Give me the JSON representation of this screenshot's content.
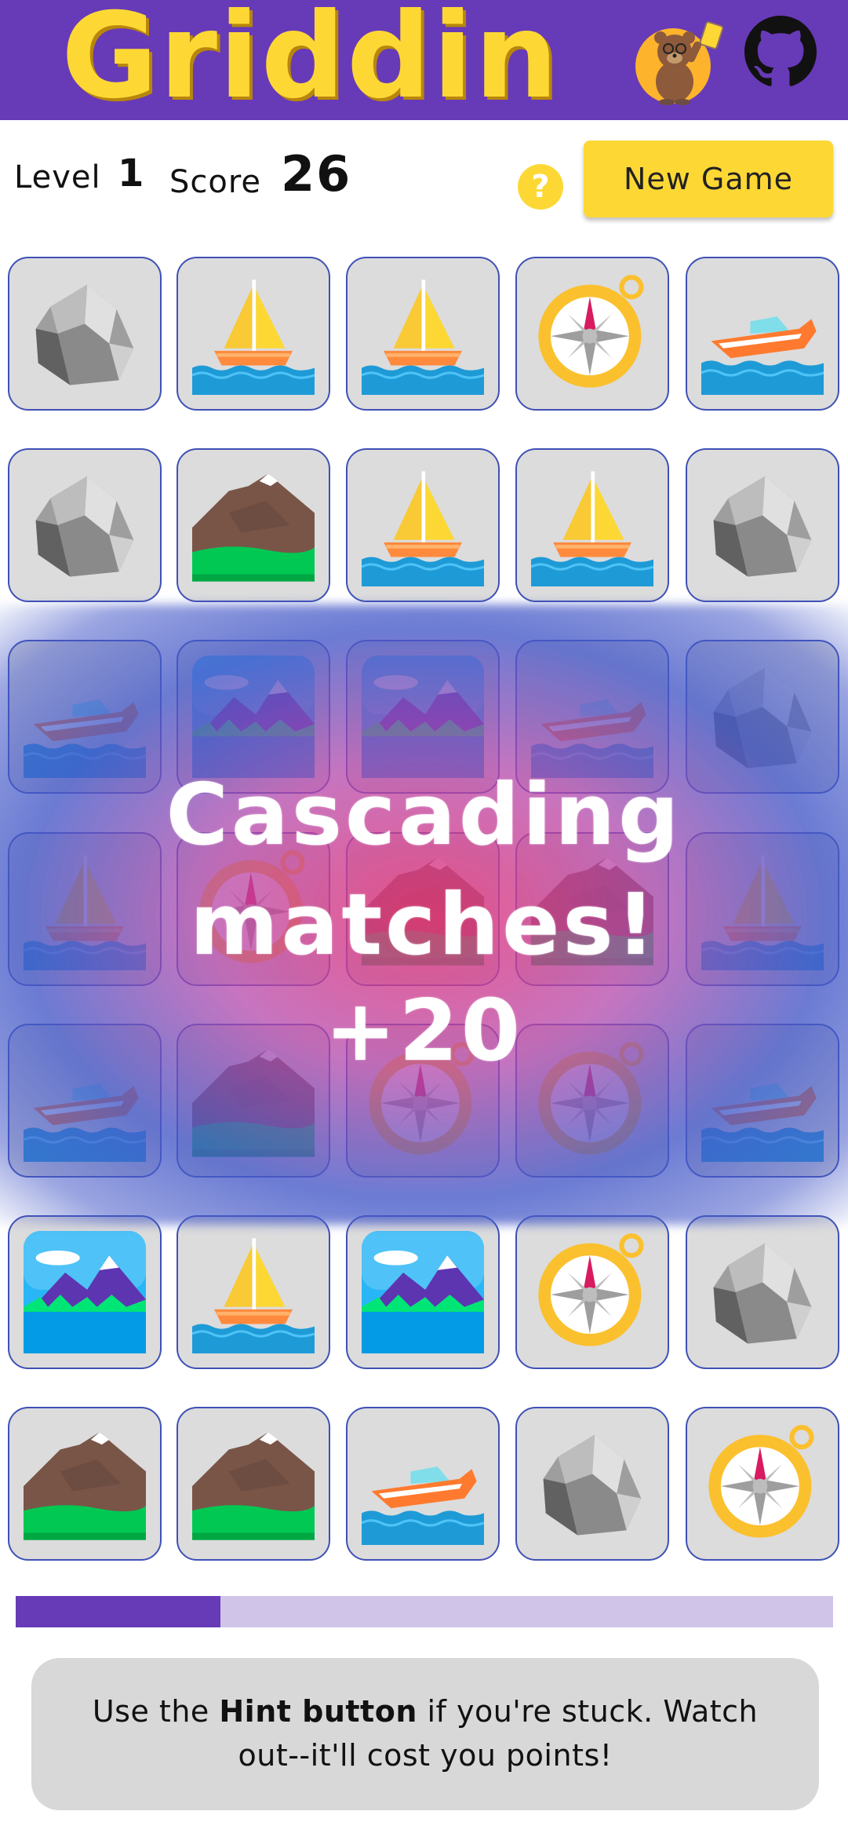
{
  "header": {
    "title": "Griddin",
    "accent": "#673ab7",
    "logo_color": "#fdd835",
    "icons": [
      "bear-mascot-icon",
      "github-icon"
    ]
  },
  "status": {
    "level_label": "Level",
    "level_value": "1",
    "score_label": "Score",
    "score_value": "26",
    "hint_symbol": "?",
    "new_game_label": "New Game"
  },
  "board": {
    "rows": [
      [
        "rock",
        "sailboat",
        "sailboat",
        "compass",
        "speedboat"
      ],
      [
        "rock",
        "mountain",
        "sailboat",
        "sailboat",
        "rock"
      ],
      [
        "speedboat",
        "lake",
        "lake",
        "speedboat",
        "rock"
      ],
      [
        "sailboat",
        "compass",
        "mountain",
        "mountain",
        "sailboat"
      ],
      [
        "speedboat",
        "mountain",
        "compass",
        "compass",
        "speedboat"
      ],
      [
        "lake",
        "sailboat",
        "lake",
        "compass",
        "rock"
      ],
      [
        "mountain",
        "mountain",
        "speedboat",
        "rock",
        "compass"
      ]
    ]
  },
  "overlay": {
    "line1": "Cascading",
    "line2": "matches!",
    "line3": "+20"
  },
  "progress": {
    "value": 0.25
  },
  "tip": {
    "before": "Use the ",
    "bold": "Hint button",
    "after": " if you're stuck. Watch out--it'll cost you points!"
  }
}
